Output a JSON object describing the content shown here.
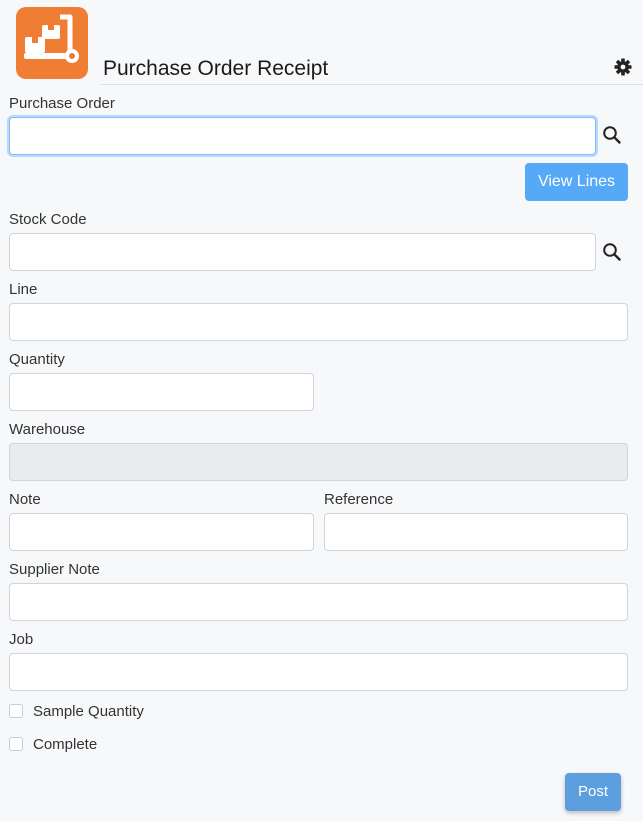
{
  "app": {
    "title": "Purchase Order Receipt",
    "logo_icon": "hand-truck-icon",
    "brand_color": "#f07d34",
    "settings_icon": "gear-icon"
  },
  "form": {
    "purchase_order": {
      "label": "Purchase Order",
      "value": "",
      "placeholder": ""
    },
    "view_lines_label": "View Lines",
    "stock_code": {
      "label": "Stock Code",
      "value": "",
      "placeholder": ""
    },
    "line": {
      "label": "Line",
      "value": "",
      "placeholder": ""
    },
    "quantity": {
      "label": "Quantity",
      "value": "",
      "placeholder": ""
    },
    "warehouse": {
      "label": "Warehouse",
      "value": "",
      "placeholder": ""
    },
    "note": {
      "label": "Note",
      "value": "",
      "placeholder": ""
    },
    "reference": {
      "label": "Reference",
      "value": "",
      "placeholder": ""
    },
    "supplier_note": {
      "label": "Supplier Note",
      "value": "",
      "placeholder": ""
    },
    "job": {
      "label": "Job",
      "value": "",
      "placeholder": ""
    },
    "sample_quantity": {
      "label": "Sample Quantity",
      "checked": false
    },
    "complete": {
      "label": "Complete",
      "checked": false
    },
    "post_label": "Post"
  },
  "colors": {
    "primary_button": "#55a9f6",
    "post_button": "#5b9fde",
    "focus_border": "#80bdff"
  }
}
